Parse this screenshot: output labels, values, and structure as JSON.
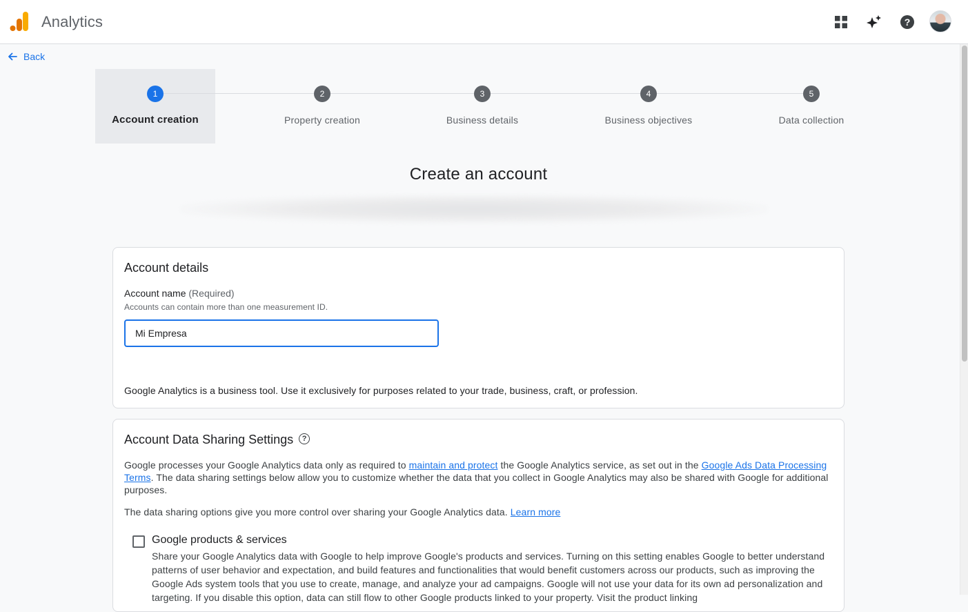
{
  "header": {
    "app_title": "Analytics",
    "logo_icon": "analytics-bars-icon",
    "icons": [
      "apps-grid-icon",
      "sparkle-icon",
      "help-icon",
      "avatar"
    ]
  },
  "nav": {
    "back_label": "Back"
  },
  "stepper": {
    "steps": [
      {
        "number": "1",
        "label": "Account creation"
      },
      {
        "number": "2",
        "label": "Property creation"
      },
      {
        "number": "3",
        "label": "Business details"
      },
      {
        "number": "4",
        "label": "Business objectives"
      },
      {
        "number": "5",
        "label": "Data collection"
      }
    ],
    "active_step": 1
  },
  "page": {
    "title": "Create an account"
  },
  "account_details": {
    "title": "Account details",
    "field_label": "Account name",
    "field_required": "(Required)",
    "field_hint": "Accounts can contain more than one measurement ID.",
    "field_value": "Mi Empresa",
    "disclaimer": "Google Analytics is a business tool. Use it exclusively for purposes related to your trade, business, craft, or profession."
  },
  "data_sharing": {
    "title": "Account Data Sharing Settings",
    "para1_part1": "Google processes your Google Analytics data only as required to ",
    "para1_link1": "maintain and protect",
    "para1_part2": " the Google Analytics service, as set out in the ",
    "para1_link2": "Google Ads Data Processing Terms",
    "para1_part3": ". The data sharing settings below allow you to customize whether the data that you collect in Google Analytics may also be shared with Google for additional purposes.",
    "para2": "The data sharing options give you more control over sharing your Google Analytics data. ",
    "para2_link": "Learn more",
    "option": {
      "title": "Google products & services",
      "checked": false,
      "description": "Share your Google Analytics data with Google to help improve Google's products and services. Turning on this setting enables Google to better understand patterns of user behavior and expectation, and build features and functionalities that would benefit customers across our products, such as improving the Google Ads system tools that you use to create, manage, and analyze your ad campaigns. Google will not use your data for its own ad personalization and targeting. If you disable this option, data can still flow to other Google products linked to your property. Visit the product linking"
    }
  },
  "colors": {
    "accent": "#1a73e8",
    "logo_orange": "#f9ab00",
    "logo_dark_orange": "#e37400",
    "step_inactive": "#5f6368"
  }
}
